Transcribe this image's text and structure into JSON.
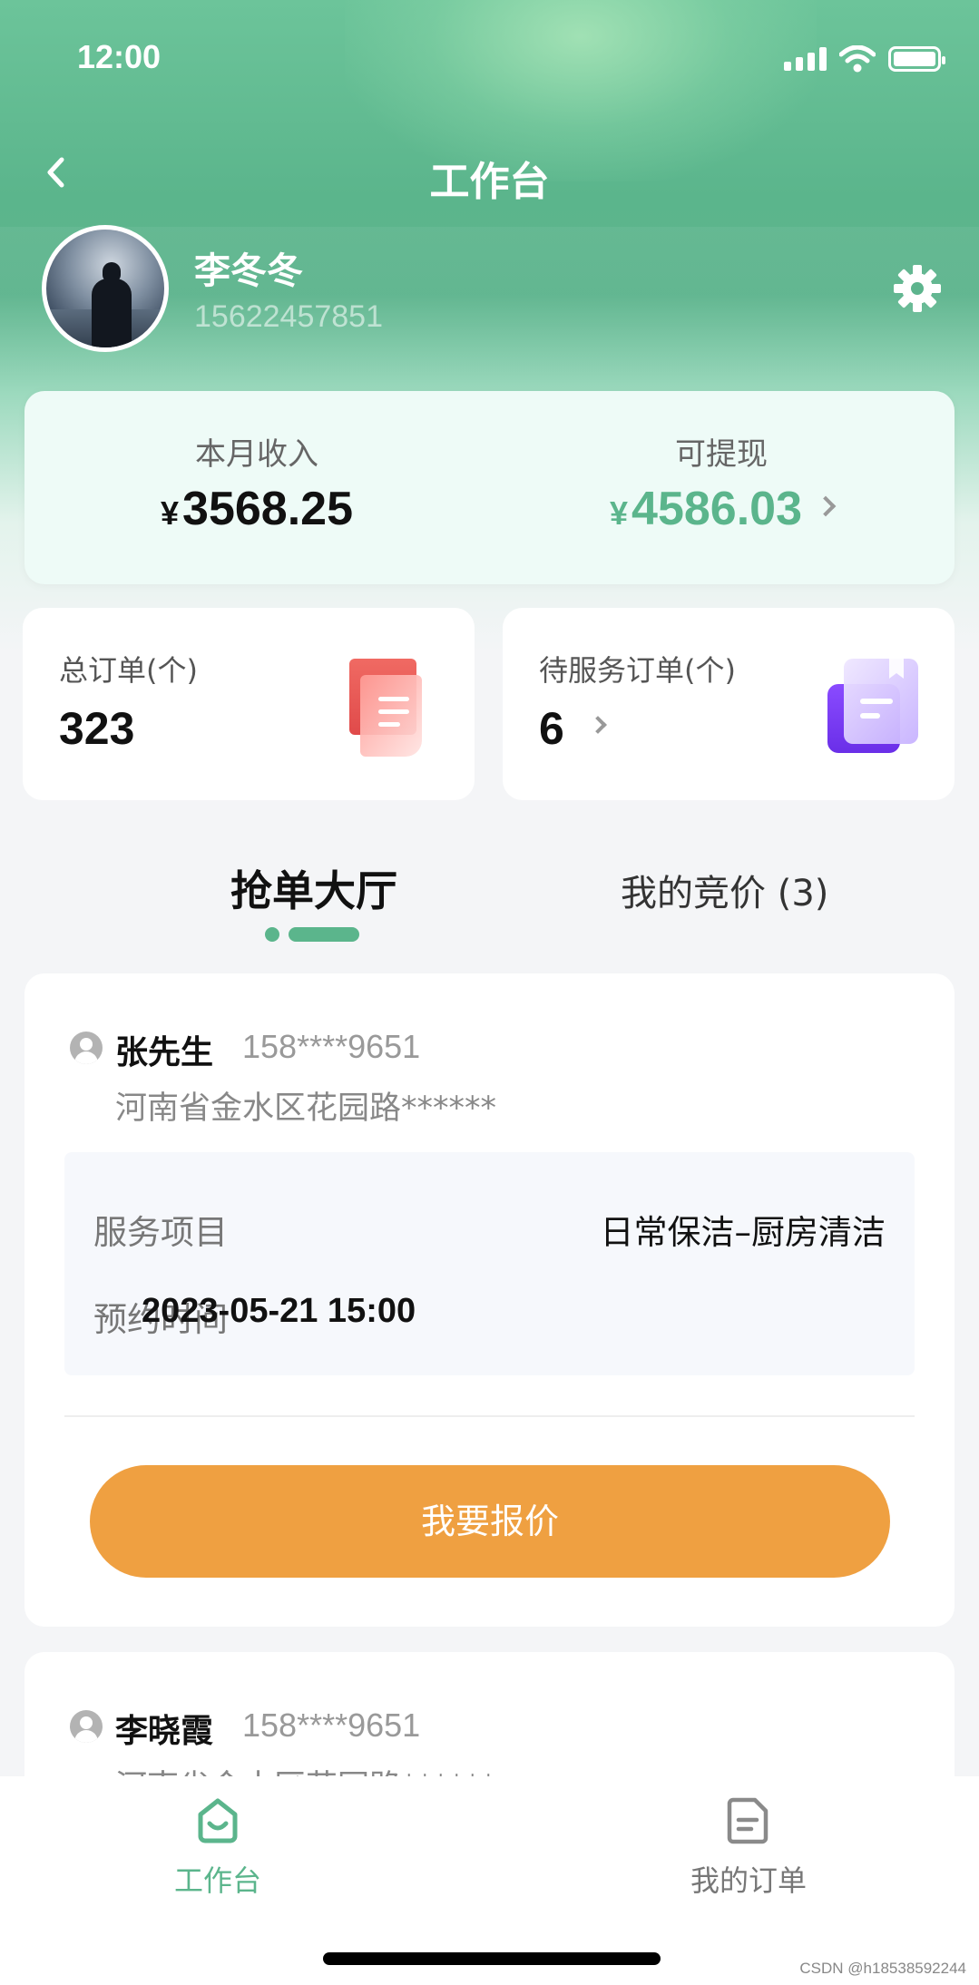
{
  "status_bar": {
    "time": "12:00"
  },
  "nav": {
    "title": "工作台"
  },
  "profile": {
    "name": "李冬冬",
    "phone": "15622457851"
  },
  "income": {
    "month_label": "本月收入",
    "month_value": "3568.25",
    "withdraw_label": "可提现",
    "withdraw_value": "4586.03",
    "currency": "¥"
  },
  "stats": {
    "total_orders_label": "总订单(个)",
    "total_orders_value": "323",
    "pending_orders_label": "待服务订单(个)",
    "pending_orders_value": "6"
  },
  "tabs": {
    "active": "抢单大厅",
    "other": "我的竞价 (3)"
  },
  "orders": [
    {
      "name": "张先生",
      "phone": "158****9651",
      "address": "河南省金水区花园路******",
      "service_label": "服务项目",
      "service_value": "日常保洁–厨房清洁",
      "time_label": "预约时间",
      "time_value": "2023-05-21  15:00",
      "button": "我要报价"
    },
    {
      "name": "李晓霞",
      "phone": "158****9651",
      "address": "河南省金水区花园路******"
    }
  ],
  "tabbar": {
    "home": "工作台",
    "orders": "我的订单"
  },
  "watermark": "CSDN @h18538592244",
  "colors": {
    "primary": "#5bb58c",
    "accent_button": "#efa041",
    "income_card": "#eefbf7"
  }
}
